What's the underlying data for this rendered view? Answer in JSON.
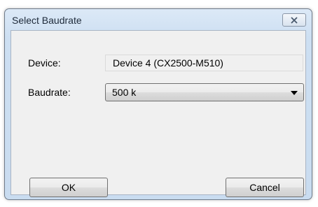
{
  "dialog": {
    "title": "Select Baudrate",
    "close_icon": "close-icon"
  },
  "fields": {
    "device_label": "Device:",
    "device_value": "Device 4 (CX2500-M510)",
    "baudrate_label": "Baudrate:",
    "baudrate_value": "500 k"
  },
  "buttons": {
    "ok": "OK",
    "cancel": "Cancel"
  },
  "colors": {
    "frame": "#cddff2",
    "client": "#f0f0f0"
  }
}
